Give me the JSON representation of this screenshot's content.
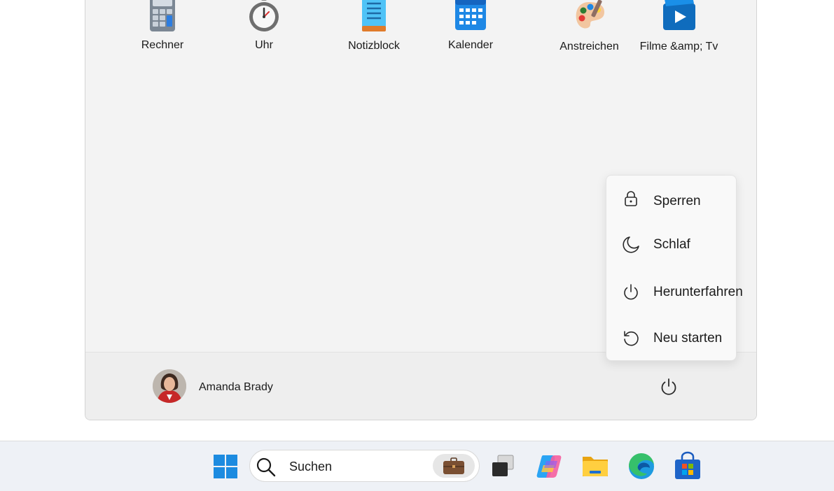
{
  "apps": [
    {
      "label": "Rechner",
      "icon": "calculator-icon"
    },
    {
      "label": "Uhr",
      "icon": "clock-icon"
    },
    {
      "label": "Notizblock",
      "icon": "notepad-icon"
    },
    {
      "label": "Kalender",
      "icon": "calendar-icon"
    },
    {
      "label": "Anstreichen",
      "icon": "paint-palette-icon"
    },
    {
      "label": "Filme &amp; Tv",
      "icon": "movies-tv-icon"
    }
  ],
  "power_menu": {
    "items": [
      {
        "label": "Sperren",
        "icon": "lock-icon"
      },
      {
        "label": "Schlaf",
        "icon": "moon-icon"
      },
      {
        "label": "Herunterfahren",
        "icon": "power-icon"
      },
      {
        "label": "Neu starten",
        "icon": "restart-icon"
      }
    ]
  },
  "user": {
    "name": "Amanda Brady"
  },
  "taskbar": {
    "search_placeholder": "Suchen",
    "icons": [
      "windows-start-icon",
      "search-icon",
      "work-briefcase-icon",
      "task-view-icon",
      "copilot-icon",
      "file-explorer-icon",
      "edge-icon",
      "store-icon"
    ]
  },
  "colors": {
    "start_bg": "#f3f3f3",
    "taskbar_bg": "#eef1f6",
    "accent_blue": "#0078d4"
  }
}
